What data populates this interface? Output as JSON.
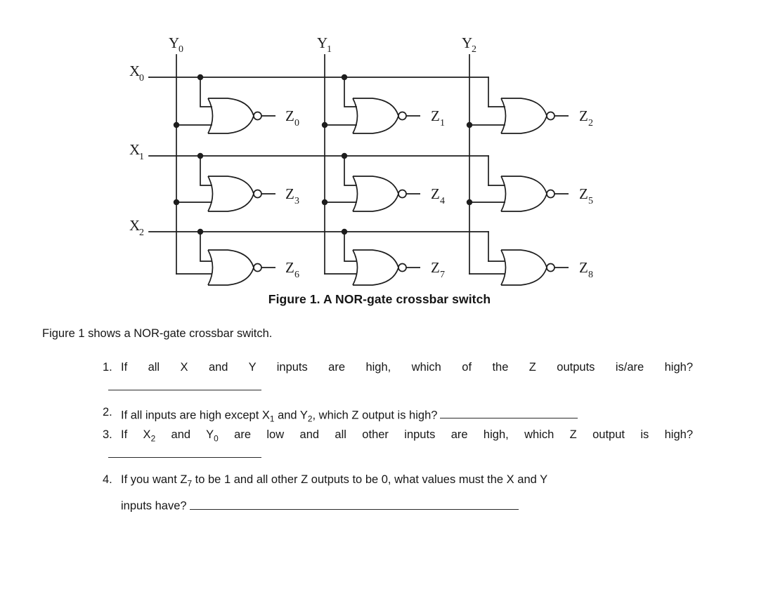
{
  "figure": {
    "caption": "Figure 1. A NOR-gate crossbar switch",
    "column_labels": [
      "Y",
      "Y",
      "Y"
    ],
    "column_subscripts": [
      "0",
      "1",
      "2"
    ],
    "row_labels": [
      "X",
      "X",
      "X"
    ],
    "row_subscripts": [
      "0",
      "1",
      "2"
    ],
    "y_labels": [
      {
        "base": "Y",
        "sub": "0"
      },
      {
        "base": "Y",
        "sub": "1"
      },
      {
        "base": "Y",
        "sub": "2"
      }
    ],
    "x_labels": [
      {
        "base": "X",
        "sub": "0"
      },
      {
        "base": "X",
        "sub": "1"
      },
      {
        "base": "X",
        "sub": "2"
      }
    ],
    "z_labels": [
      {
        "base": "Z",
        "sub": "0"
      },
      {
        "base": "Z",
        "sub": "1"
      },
      {
        "base": "Z",
        "sub": "2"
      },
      {
        "base": "Z",
        "sub": "3"
      },
      {
        "base": "Z",
        "sub": "4"
      },
      {
        "base": "Z",
        "sub": "5"
      },
      {
        "base": "Z",
        "sub": "6"
      },
      {
        "base": "Z",
        "sub": "7"
      },
      {
        "base": "Z",
        "sub": "8"
      }
    ],
    "gate_type": "NOR",
    "gate_count": 9,
    "line_color": "#1d1d1d"
  },
  "intro": {
    "text": "Figure 1 shows a NOR-gate crossbar switch."
  },
  "questions": [
    {
      "number": "1.",
      "text": "If all X and Y inputs are high, which of the Z outputs is/are high?",
      "blank": "below"
    },
    {
      "number": "2.",
      "text_before": "If all inputs are high except X",
      "sub_1": "1",
      "text_middle": " and Y",
      "sub_2": "2",
      "text_after": ", which Z output is high?",
      "blank": "inline"
    },
    {
      "number": "3.",
      "text_before": "If X",
      "sub_1": "2",
      "text_middle": " and Y",
      "sub_2": "0",
      "text_after": " are low and all other inputs are high, which Z output is high?",
      "blank": "below"
    },
    {
      "number": "4.",
      "line1_before": "If you want Z",
      "line1_sub": "7",
      "line1_after": " to be 1 and all other Z outputs to be 0, what values must the X and Y",
      "line2": "inputs have?",
      "blank": "inline"
    }
  ]
}
